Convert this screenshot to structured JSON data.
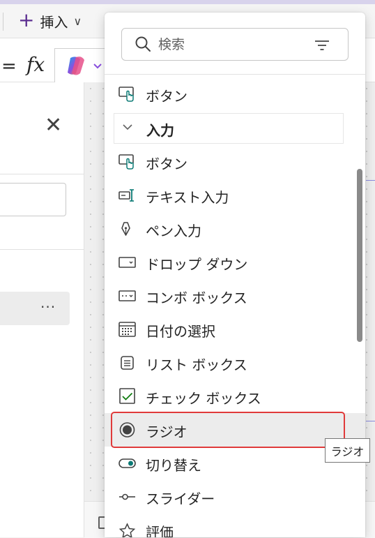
{
  "ribbon": {
    "insert_label": "挿入"
  },
  "formula_bar": {
    "equals": "=",
    "fx": "fx"
  },
  "left_pane": {
    "more_label": "···"
  },
  "insert_panel": {
    "search_placeholder": "検索",
    "top_item": {
      "label": "ボタン",
      "icon": "button-touch-icon"
    },
    "group": {
      "label": "入力",
      "expanded": true
    },
    "items": [
      {
        "label": "ボタン",
        "icon": "button-touch-icon"
      },
      {
        "label": "テキスト入力",
        "icon": "text-input-icon"
      },
      {
        "label": "ペン入力",
        "icon": "pen-icon"
      },
      {
        "label": "ドロップ ダウン",
        "icon": "dropdown-icon"
      },
      {
        "label": "コンボ ボックス",
        "icon": "combobox-icon"
      },
      {
        "label": "日付の選択",
        "icon": "calendar-icon"
      },
      {
        "label": "リスト ボックス",
        "icon": "listbox-icon"
      },
      {
        "label": "チェック ボックス",
        "icon": "checkbox-icon"
      },
      {
        "label": "ラジオ",
        "icon": "radio-icon",
        "selected": true
      },
      {
        "label": "切り替え",
        "icon": "toggle-icon"
      },
      {
        "label": "スライダー",
        "icon": "slider-icon"
      },
      {
        "label": "評価",
        "icon": "rating-icon"
      }
    ]
  },
  "tooltip": {
    "text": "ラジオ"
  },
  "colors": {
    "accent_purple": "#5b2d90",
    "teal": "#0b7a75",
    "highlight_red": "#e03a3a",
    "check_green": "#107c10"
  }
}
